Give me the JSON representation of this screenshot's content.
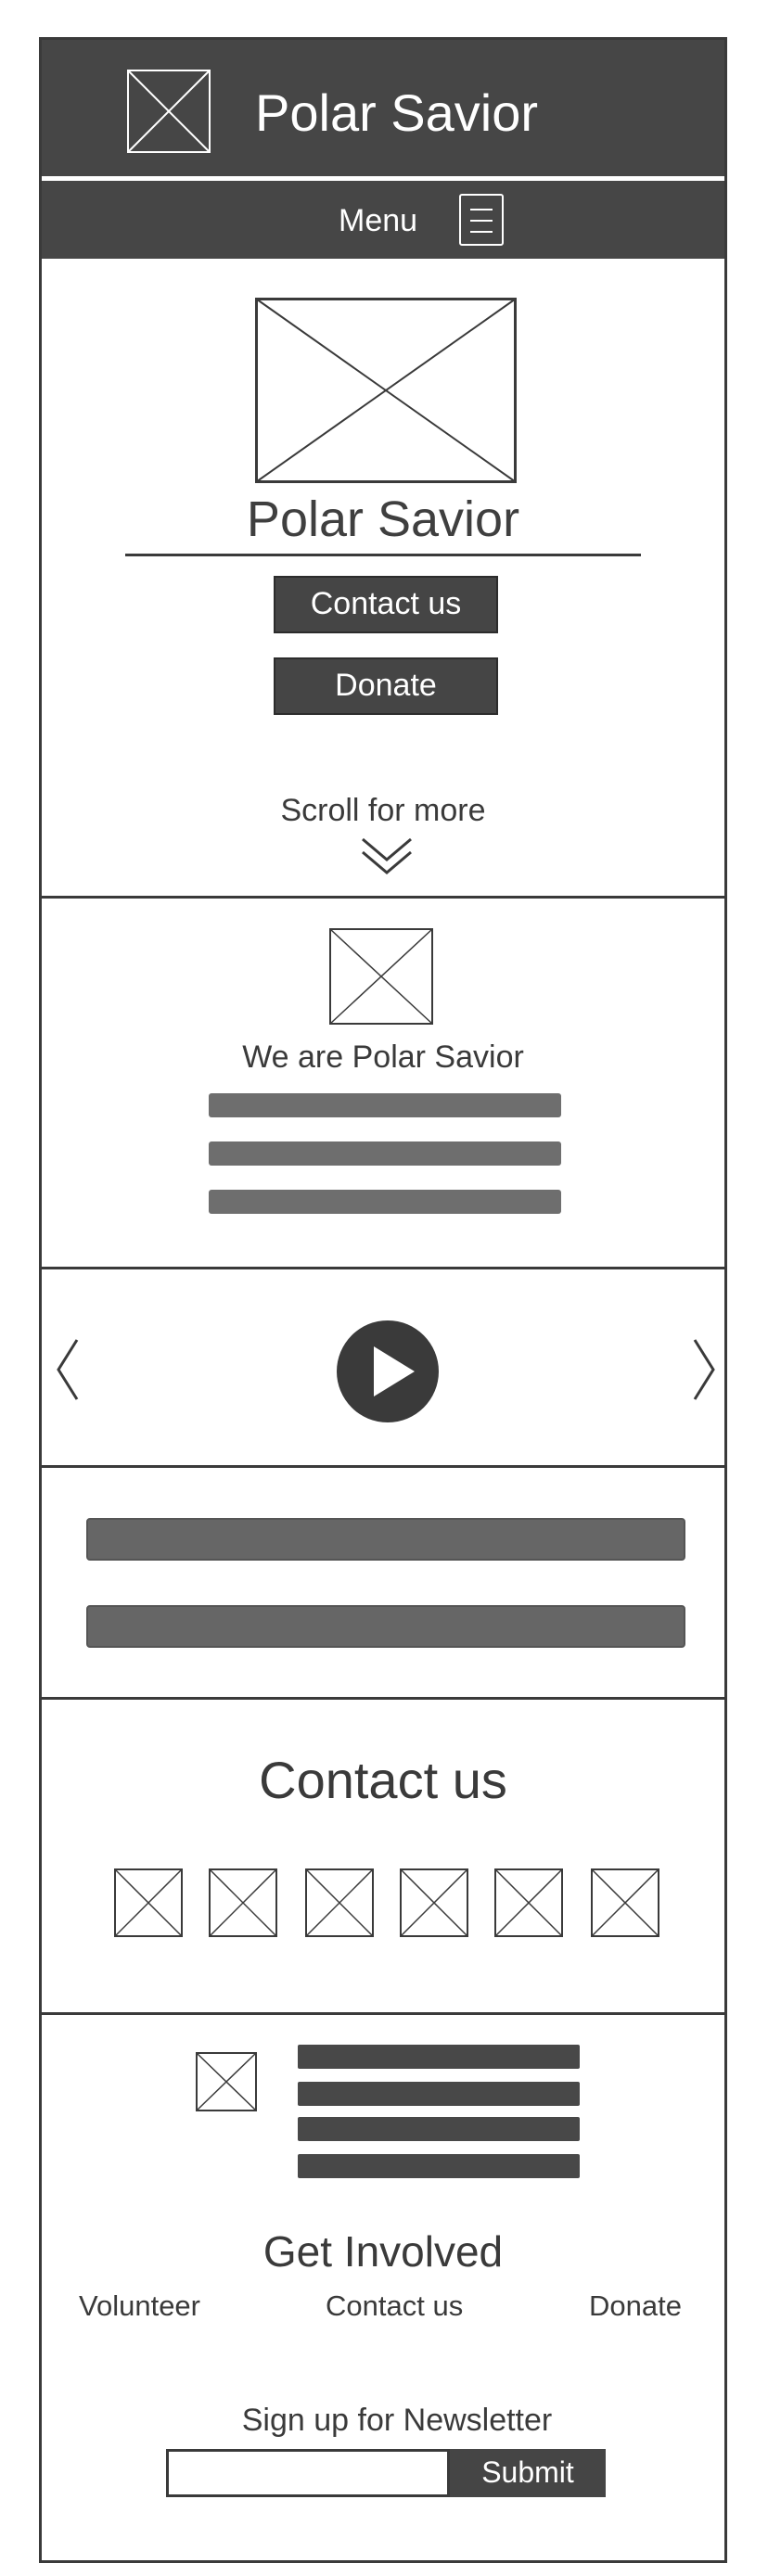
{
  "header": {
    "title": "Polar Savior",
    "logo_icon": "image-placeholder-icon"
  },
  "menubar": {
    "label": "Menu",
    "icon": "hamburger-menu-icon"
  },
  "hero": {
    "title": "Polar Savior",
    "contact_button": "Contact us",
    "donate_button": "Donate",
    "scroll_text": "Scroll for more",
    "scroll_icon": "chevron-double-down-icon"
  },
  "about": {
    "title": "We are Polar Savior",
    "text_lines": 3
  },
  "video": {
    "prev_icon": "chevron-left-icon",
    "play_icon": "play-icon",
    "next_icon": "chevron-right-icon"
  },
  "contact": {
    "title": "Contact us",
    "social_icon_count": 6
  },
  "footer": {
    "get_involved_title": "Get Involved",
    "links": [
      "Volunteer",
      "Contact us",
      "Donate"
    ],
    "newsletter_label": "Sign up for Newsletter",
    "email_placeholder": "",
    "submit_label": "Submit"
  },
  "colors": {
    "dark": "#464646",
    "bar_gray": "#6e6e6e",
    "background": "#ffffff"
  }
}
